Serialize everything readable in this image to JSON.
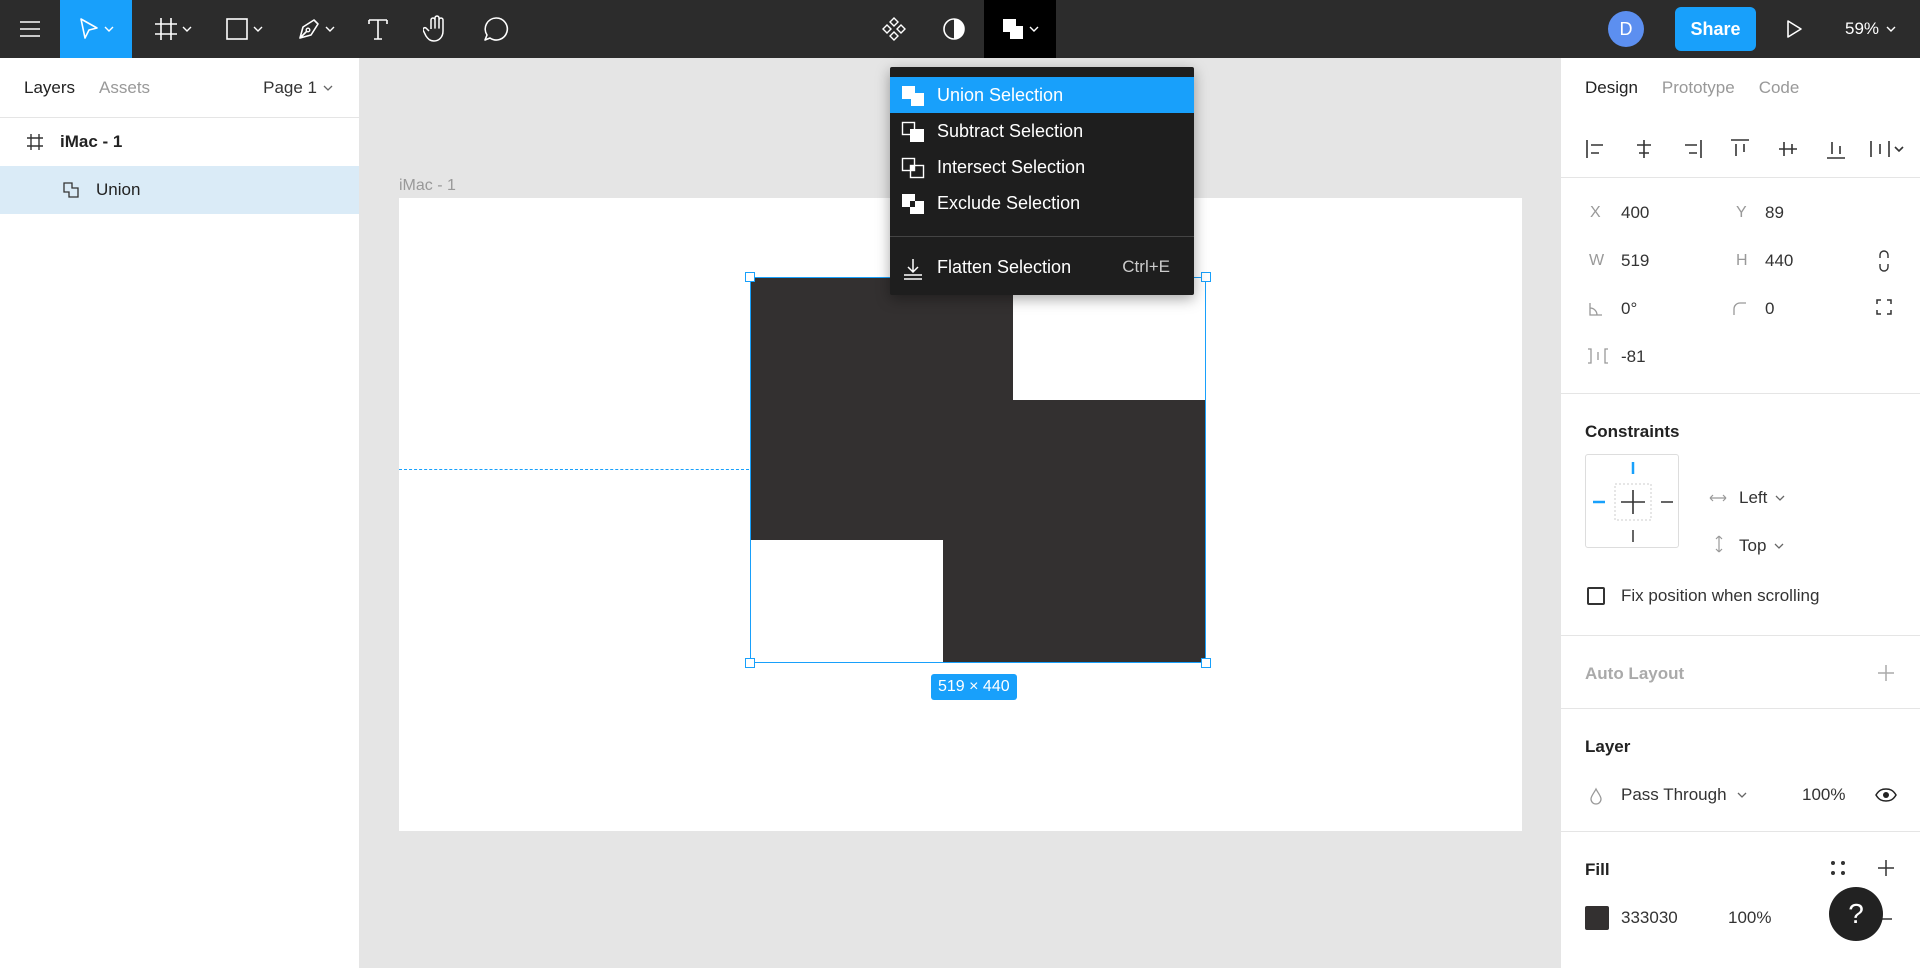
{
  "toolbar": {
    "menu_icon": "hamburger-menu-icon",
    "move_tool_icon": "move-tool-icon",
    "frame_tool_icon": "frame-tool-icon",
    "shape_tool_icon": "rectangle-tool-icon",
    "pen_tool_icon": "pen-tool-icon",
    "text_tool_icon": "text-tool-icon",
    "hand_tool_icon": "hand-tool-icon",
    "comment_tool_icon": "comment-tool-icon",
    "component_icon": "component-icon",
    "mask_icon": "mask-icon",
    "boolean_icon": "boolean-union-icon",
    "avatar_initial": "D",
    "avatar_color": "#5c8ff0",
    "share_label": "Share",
    "present_icon": "play-icon",
    "zoom": "59%",
    "accent": "#18a0fb"
  },
  "left_panel": {
    "tabs": {
      "layers": "Layers",
      "assets": "Assets"
    },
    "page_selector": "Page 1",
    "layers": [
      {
        "name": "iMac - 1",
        "icon": "frame-icon"
      },
      {
        "name": "Union",
        "icon": "boolean-union-icon",
        "selected": true
      }
    ]
  },
  "canvas": {
    "frame_label": "iMac - 1",
    "size_badge": "519 × 440",
    "shape_fill": "#333030"
  },
  "boolean_menu": {
    "items": [
      {
        "label": "Union Selection",
        "icon": "union-icon",
        "highlighted": true
      },
      {
        "label": "Subtract Selection",
        "icon": "subtract-icon"
      },
      {
        "label": "Intersect Selection",
        "icon": "intersect-icon"
      },
      {
        "label": "Exclude Selection",
        "icon": "exclude-icon"
      }
    ],
    "flatten": {
      "label": "Flatten Selection",
      "shortcut": "Ctrl+E",
      "icon": "flatten-icon"
    }
  },
  "right_panel": {
    "tabs": {
      "design": "Design",
      "prototype": "Prototype",
      "code": "Code"
    },
    "position": {
      "x_label": "X",
      "x": "400",
      "y_label": "Y",
      "y": "89",
      "w_label": "W",
      "w": "519",
      "h_label": "H",
      "h": "440",
      "rotation": "0°",
      "radius": "0",
      "spacing": "-81"
    },
    "constraints": {
      "title": "Constraints",
      "horizontal": "Left",
      "vertical": "Top",
      "fix_label": "Fix position when scrolling"
    },
    "auto_layout": {
      "title": "Auto Layout"
    },
    "layer": {
      "title": "Layer",
      "blend": "Pass Through",
      "opacity": "100%"
    },
    "fill": {
      "title": "Fill",
      "hex": "333030",
      "opacity": "100%",
      "color": "#333030"
    }
  },
  "help_label": "?"
}
